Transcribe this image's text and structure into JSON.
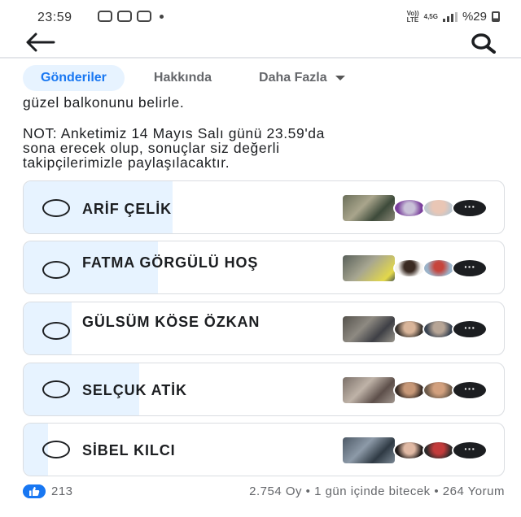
{
  "status_bar": {
    "time": "23:59",
    "network_top": "Vo))",
    "network_bottom": "LTE",
    "net_type_top": "4,5G",
    "battery_text": "%29"
  },
  "tabs": [
    {
      "label": "Gönderiler"
    },
    {
      "label": "Hakkında"
    },
    {
      "label": "Daha Fazla"
    }
  ],
  "post": {
    "line_top": "güzel balkonunu belirle.",
    "note_line1": "NOT: Anketimiz 14 Mayıs Salı günü 23.59'da",
    "note_line2": "sona erecek olup, sonuçlar siz değerli",
    "note_line3": "takipçilerimizle paylaşılacaktır."
  },
  "poll": {
    "options": [
      {
        "label": "ARİF ÇELİK",
        "vote_share": 0.31
      },
      {
        "label": "FATMA GÖRGÜLÜ HOŞ",
        "vote_share": 0.28
      },
      {
        "label": "GÜLSÜM KÖSE ÖZKAN",
        "vote_share": 0.1
      },
      {
        "label": "SELÇUK ATİK",
        "vote_share": 0.24
      },
      {
        "label": "SİBEL KILCI",
        "vote_share": 0.05
      }
    ],
    "more_voters_label": "···"
  },
  "footer": {
    "likes": "213",
    "summary": "2.754 Oy • 1 gün içinde bitecek • 264 Yorum"
  },
  "colors": {
    "accent": "#1877f2",
    "active_tab_bg": "#e7f3ff",
    "poll_fill": "#e7f3ff"
  },
  "icons": [
    "back-arrow-icon",
    "search-icon",
    "dropdown-caret-icon",
    "like-icon",
    "radio-button-icon"
  ]
}
